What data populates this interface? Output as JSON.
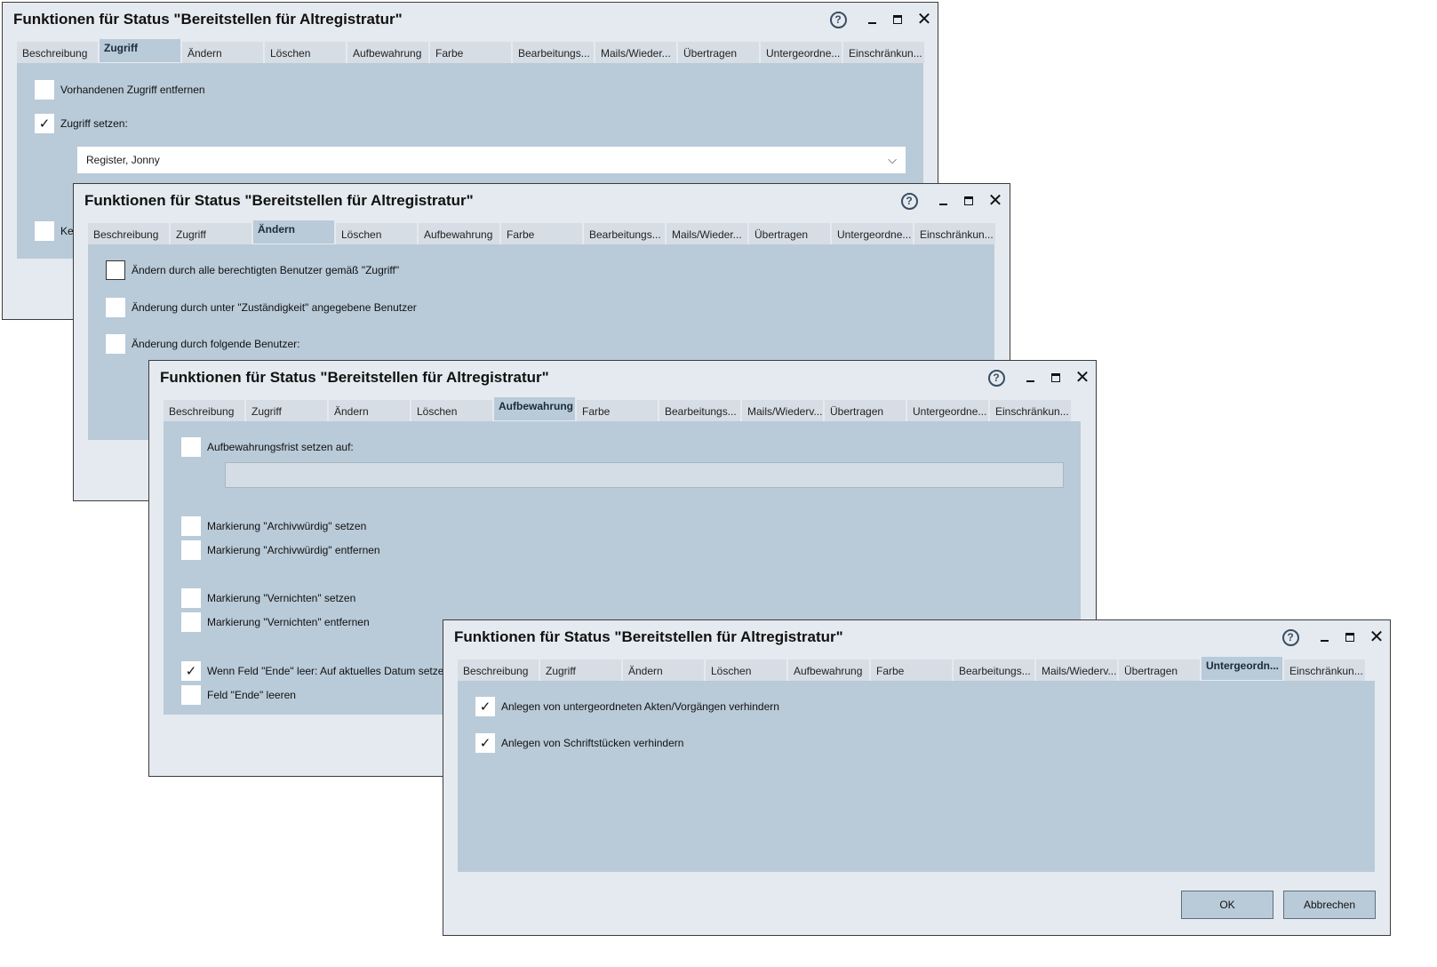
{
  "dialog_title": "Funktionen für Status \"Bereitstellen für Altregistratur\"",
  "window_buttons": {
    "help": "?",
    "close": "✕"
  },
  "tabs_w1": [
    "Beschreibung",
    "Zugriff",
    "Ändern",
    "Löschen",
    "Aufbewahrung",
    "Farbe",
    "Bearbeitungs...",
    "Mails/Wieder...",
    "Übertragen",
    "Untergeordne...",
    "Einschränkun..."
  ],
  "tabs_w2": [
    "Beschreibung",
    "Zugriff",
    "Ändern",
    "Löschen",
    "Aufbewahrung",
    "Farbe",
    "Bearbeitungs...",
    "Mails/Wieder...",
    "Übertragen",
    "Untergeordne...",
    "Einschränkun..."
  ],
  "tabs_w3": [
    "Beschreibung",
    "Zugriff",
    "Ändern",
    "Löschen",
    "Aufbewahrung",
    "Farbe",
    "Bearbeitungs...",
    "Mails/Wiederv...",
    "Übertragen",
    "Untergeordne...",
    "Einschränkun..."
  ],
  "tabs_w4": [
    "Beschreibung",
    "Zugriff",
    "Ändern",
    "Löschen",
    "Aufbewahrung",
    "Farbe",
    "Bearbeitungs...",
    "Mails/Wiederv...",
    "Übertragen",
    "Untergeordn...",
    "Einschränkun..."
  ],
  "w1": {
    "active_tab": "Zugriff",
    "remove_access": {
      "label": "Vorhandenen Zugriff entfernen",
      "checked": false
    },
    "set_access": {
      "label": "Zugriff setzen:",
      "checked": true
    },
    "user_combo": {
      "value": "Register, Jonny",
      "arrow": "⌵"
    },
    "partial_label": "Kei",
    "checkmark": "✓"
  },
  "w2": {
    "active_tab": "Ändern",
    "options": [
      {
        "label": "Ändern durch alle berechtigten Benutzer gemäß \"Zugriff\"",
        "checked": false
      },
      {
        "label": "Änderung durch unter \"Zuständigkeit\" angegebene Benutzer",
        "checked": false
      },
      {
        "label": "Änderung durch folgende Benutzer:",
        "checked": false
      }
    ]
  },
  "w3": {
    "active_tab": "Aufbewahrung",
    "retention": {
      "label": "Aufbewahrungsfrist setzen auf:",
      "checked": false
    },
    "options": [
      {
        "label": "Markierung \"Archivwürdig\" setzen",
        "checked": false
      },
      {
        "label": "Markierung \"Archivwürdig\" entfernen",
        "checked": false
      },
      {
        "label": "Markierung \"Vernichten\" setzen",
        "checked": false
      },
      {
        "label": "Markierung \"Vernichten\" entfernen",
        "checked": false
      },
      {
        "label": "Wenn Feld \"Ende\" leer: Auf aktuelles Datum setzen",
        "checked": true,
        "mark": "✓"
      },
      {
        "label": "Feld \"Ende\" leeren",
        "checked": false
      }
    ]
  },
  "w4": {
    "active_tab": "Untergeordn...",
    "options": [
      {
        "label": "Anlegen von untergeordneten Akten/Vorgängen verhindern",
        "checked": true,
        "mark": "✓"
      },
      {
        "label": "Anlegen von Schriftstücken verhindern",
        "checked": true,
        "mark": "✓"
      }
    ],
    "ok_label": "OK",
    "cancel_label": "Abbrechen"
  },
  "colors": {
    "window_bg": "#e5eaf0",
    "panel_bg": "#b9cad8",
    "tab_bg": "#d6dde5"
  }
}
